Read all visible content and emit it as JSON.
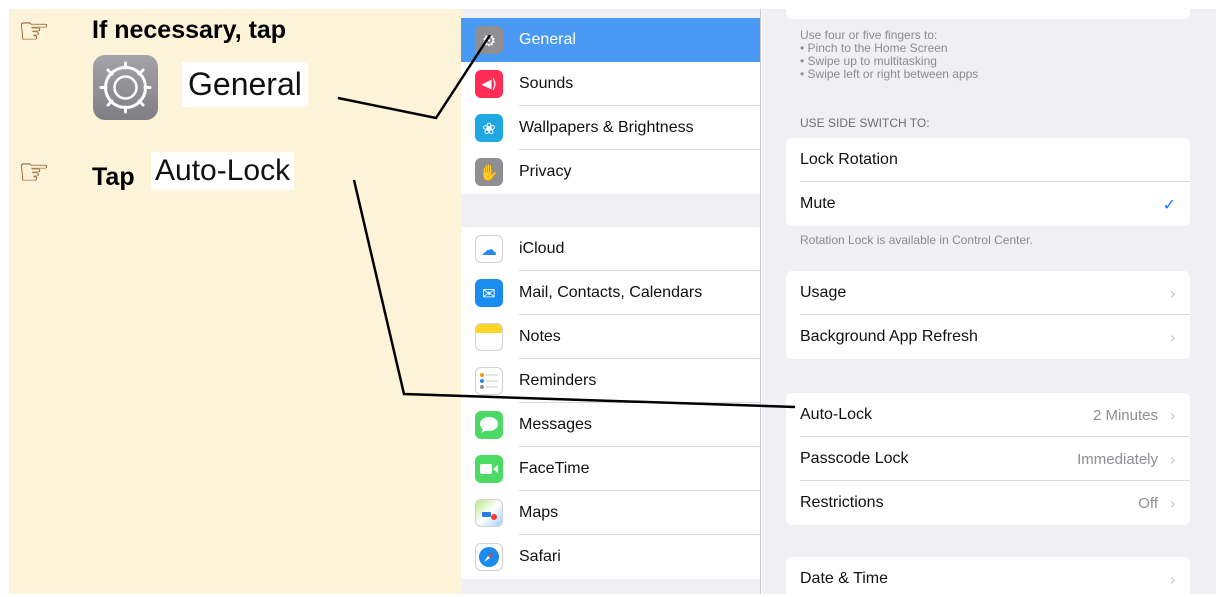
{
  "instructions": {
    "step1": {
      "text": "If necessary, tap",
      "icon": "pointing-hand-icon",
      "target_label": "General",
      "target_icon": "gear-icon"
    },
    "step2": {
      "text": "Tap",
      "icon": "pointing-hand-icon",
      "target_label": "Auto-Lock"
    }
  },
  "sidebar": {
    "group1": [
      {
        "label": "General",
        "icon": "gear-icon",
        "color": "#8e8e93",
        "selected": true
      },
      {
        "label": "Sounds",
        "icon": "speaker-icon",
        "color": "#ff2d55"
      },
      {
        "label": "Wallpapers & Brightness",
        "icon": "flower-icon",
        "color": "#1ea7e1"
      },
      {
        "label": "Privacy",
        "icon": "hand-icon",
        "color": "#8e8e93"
      }
    ],
    "group2": [
      {
        "label": "iCloud",
        "icon": "cloud-icon",
        "color": "#ffffff"
      },
      {
        "label": "Mail, Contacts, Calendars",
        "icon": "mail-icon",
        "color": "#1a8cf0"
      },
      {
        "label": "Notes",
        "icon": "notes-icon",
        "color": "#ffffff"
      },
      {
        "label": "Reminders",
        "icon": "reminders-icon",
        "color": "#ffffff"
      },
      {
        "label": "Messages",
        "icon": "messages-icon",
        "color": "#4cd964"
      },
      {
        "label": "FaceTime",
        "icon": "facetime-icon",
        "color": "#4cd964"
      },
      {
        "label": "Maps",
        "icon": "maps-icon",
        "color": "#ffffff"
      },
      {
        "label": "Safari",
        "icon": "safari-icon",
        "color": "#ffffff"
      }
    ]
  },
  "detail": {
    "multitasking_note": [
      "Use four or five fingers to:",
      "• Pinch to the Home Screen",
      "• Swipe up to multitasking",
      "• Swipe left or right between apps"
    ],
    "side_switch_header": "USE SIDE SWITCH TO:",
    "side_switch_rows": [
      {
        "label": "Lock Rotation"
      },
      {
        "label": "Mute",
        "checked": true,
        "check_glyph": "✓"
      }
    ],
    "side_switch_footer": "Rotation Lock is available in Control Center.",
    "usage_rows": [
      {
        "label": "Usage"
      },
      {
        "label": "Background App Refresh"
      }
    ],
    "lock_rows": [
      {
        "label": "Auto-Lock",
        "value": "2 Minutes"
      },
      {
        "label": "Passcode Lock",
        "value": "Immediately"
      },
      {
        "label": "Restrictions",
        "value": "Off"
      }
    ],
    "datetime_rows": [
      {
        "label": "Date & Time"
      }
    ]
  },
  "colors": {
    "accent": "#4a9af5",
    "check": "#1a7cf5",
    "instruction_bg": "#fdf3d8"
  }
}
